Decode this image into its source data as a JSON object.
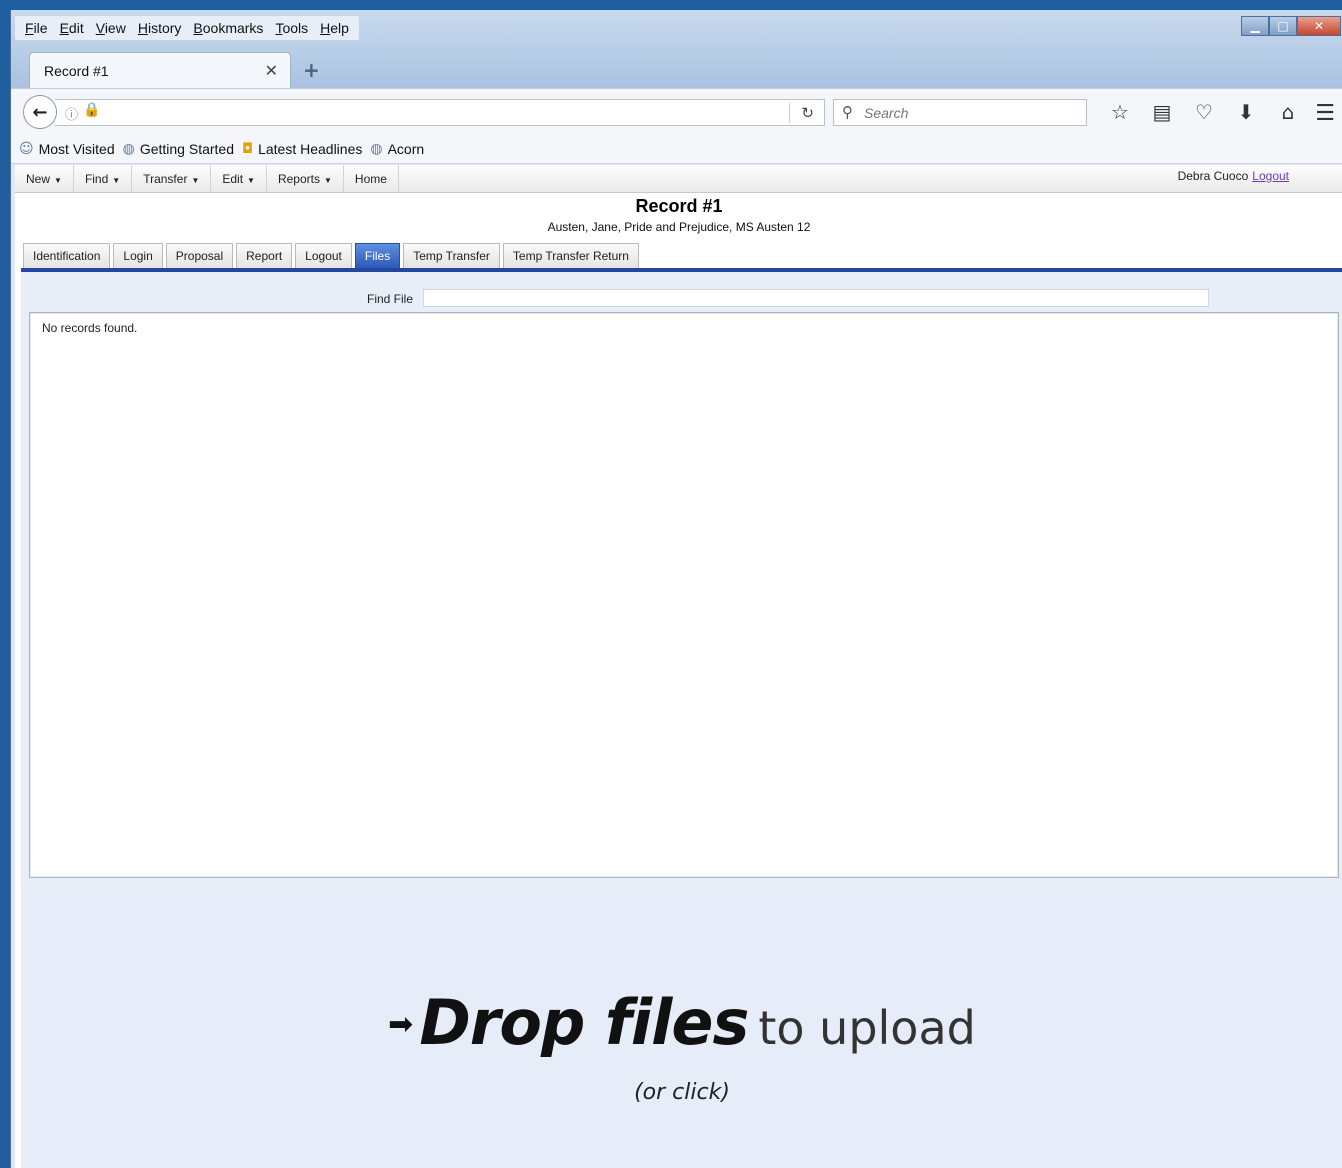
{
  "browser": {
    "menu": [
      "File",
      "Edit",
      "View",
      "History",
      "Bookmarks",
      "Tools",
      "Help"
    ],
    "tab_title": "Record #1",
    "new_tab_symbol": "+",
    "search_placeholder": "Search",
    "bookmarks": [
      {
        "label": "Most Visited",
        "icon": "user-icon"
      },
      {
        "label": "Getting Started",
        "icon": "globe-icon"
      },
      {
        "label": "Latest Headlines",
        "icon": "rss-icon"
      },
      {
        "label": "Acorn",
        "icon": "globe-icon"
      }
    ]
  },
  "app": {
    "menu": [
      {
        "label": "New",
        "has_caret": true
      },
      {
        "label": "Find",
        "has_caret": true
      },
      {
        "label": "Transfer",
        "has_caret": true
      },
      {
        "label": "Edit",
        "has_caret": true
      },
      {
        "label": "Reports",
        "has_caret": true
      },
      {
        "label": "Home",
        "has_caret": false
      }
    ],
    "user_name": "Debra Cuoco",
    "logout_link": "Logout",
    "record_title": "Record #1",
    "record_subtitle": "Austen, Jane, Pride and Prejudice, MS Austen 12",
    "tabs": [
      "Identification",
      "Login",
      "Proposal",
      "Report",
      "Logout",
      "Files",
      "Temp Transfer",
      "Temp Transfer Return"
    ],
    "active_tab": "Files",
    "find_file_label": "Find File",
    "empty_message": "No records found.",
    "dropzone": {
      "strong": "Drop files",
      "light": "to upload",
      "sub": "(or click)"
    }
  },
  "colors": {
    "active_tab": "#2c5bb8",
    "rule": "#2546a0",
    "panel_bg": "#e8eef8",
    "logout_link": "#6a3fb2"
  }
}
